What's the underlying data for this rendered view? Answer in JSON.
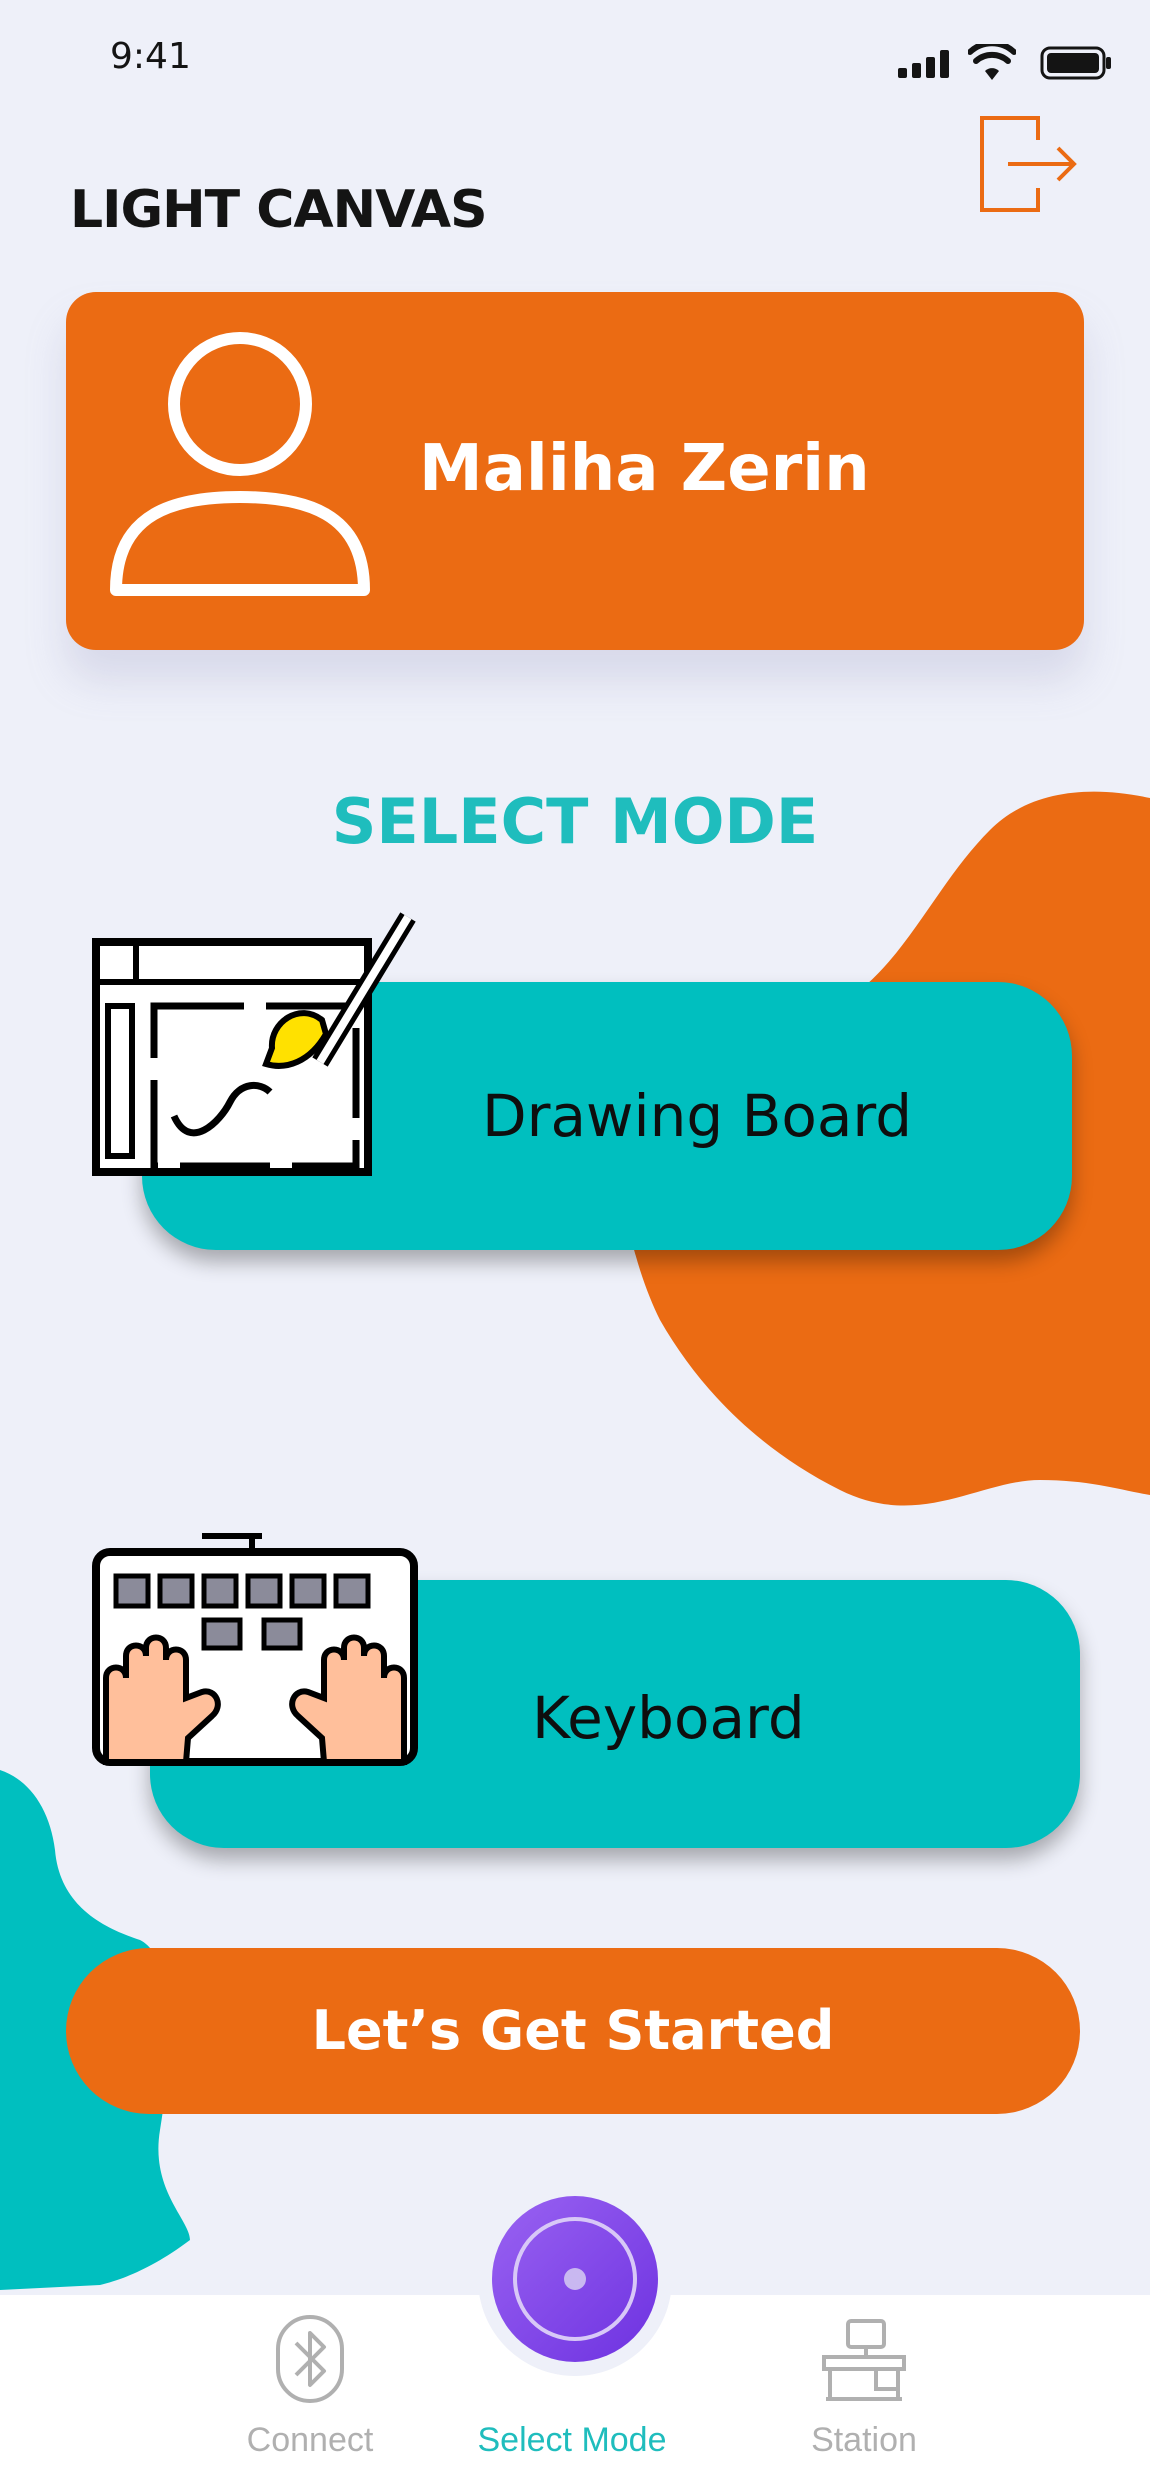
{
  "status_bar": {
    "time": "9:41"
  },
  "header": {
    "title": "LIGHT CANVAS"
  },
  "profile": {
    "name": "Maliha Zerin"
  },
  "section": {
    "title": "SELECT MODE"
  },
  "modes": [
    {
      "label": "Drawing Board",
      "icon": "drawing-tablet-icon"
    },
    {
      "label": "Keyboard",
      "icon": "keyboard-hands-icon"
    }
  ],
  "cta": {
    "label": "Let’s Get Started"
  },
  "tabbar": {
    "items": [
      {
        "label": "Connect",
        "icon": "bluetooth-icon",
        "active": false
      },
      {
        "label": "Select Mode",
        "icon": "center-action-icon",
        "active": true
      },
      {
        "label": "Station",
        "icon": "desk-icon",
        "active": false
      }
    ]
  },
  "colors": {
    "accent_orange": "#eb6b13",
    "accent_teal": "#00bfbf",
    "active_tab": "#1fbdbd",
    "inactive_tab": "#b0b0b0",
    "fab_purple": "#7a3ee6"
  }
}
